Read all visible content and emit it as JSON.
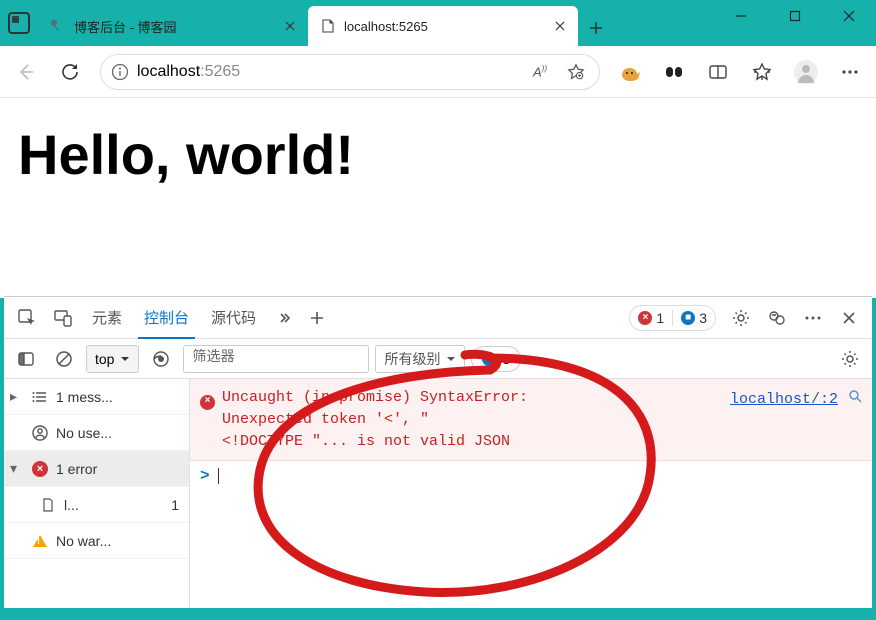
{
  "tabs": {
    "inactive": {
      "title": "博客后台 - 博客园"
    },
    "active": {
      "title": "localhost:5265"
    }
  },
  "address": {
    "host": "localhost",
    "port": ":5265"
  },
  "page": {
    "heading": "Hello, world!"
  },
  "devtools": {
    "tabs": {
      "elements": "元素",
      "console": "控制台",
      "sources": "源代码"
    },
    "issue_counts": {
      "errors": "1",
      "infos": "3"
    },
    "filterbar": {
      "context": "top",
      "filter_placeholder": "筛选器",
      "level_label": "所有级别",
      "issues_count": "3"
    },
    "sidebar": {
      "messages": "1 mess...",
      "no_user": "No use...",
      "errors_label": "1 error",
      "log_file": "l...",
      "log_file_count": "1",
      "no_warn": "No war..."
    },
    "log": {
      "text": "Uncaught (in promise) SyntaxError:\nUnexpected token '<', \"\n<!DOCTYPE \"... is not valid JSON",
      "source": "localhost/:2"
    }
  }
}
